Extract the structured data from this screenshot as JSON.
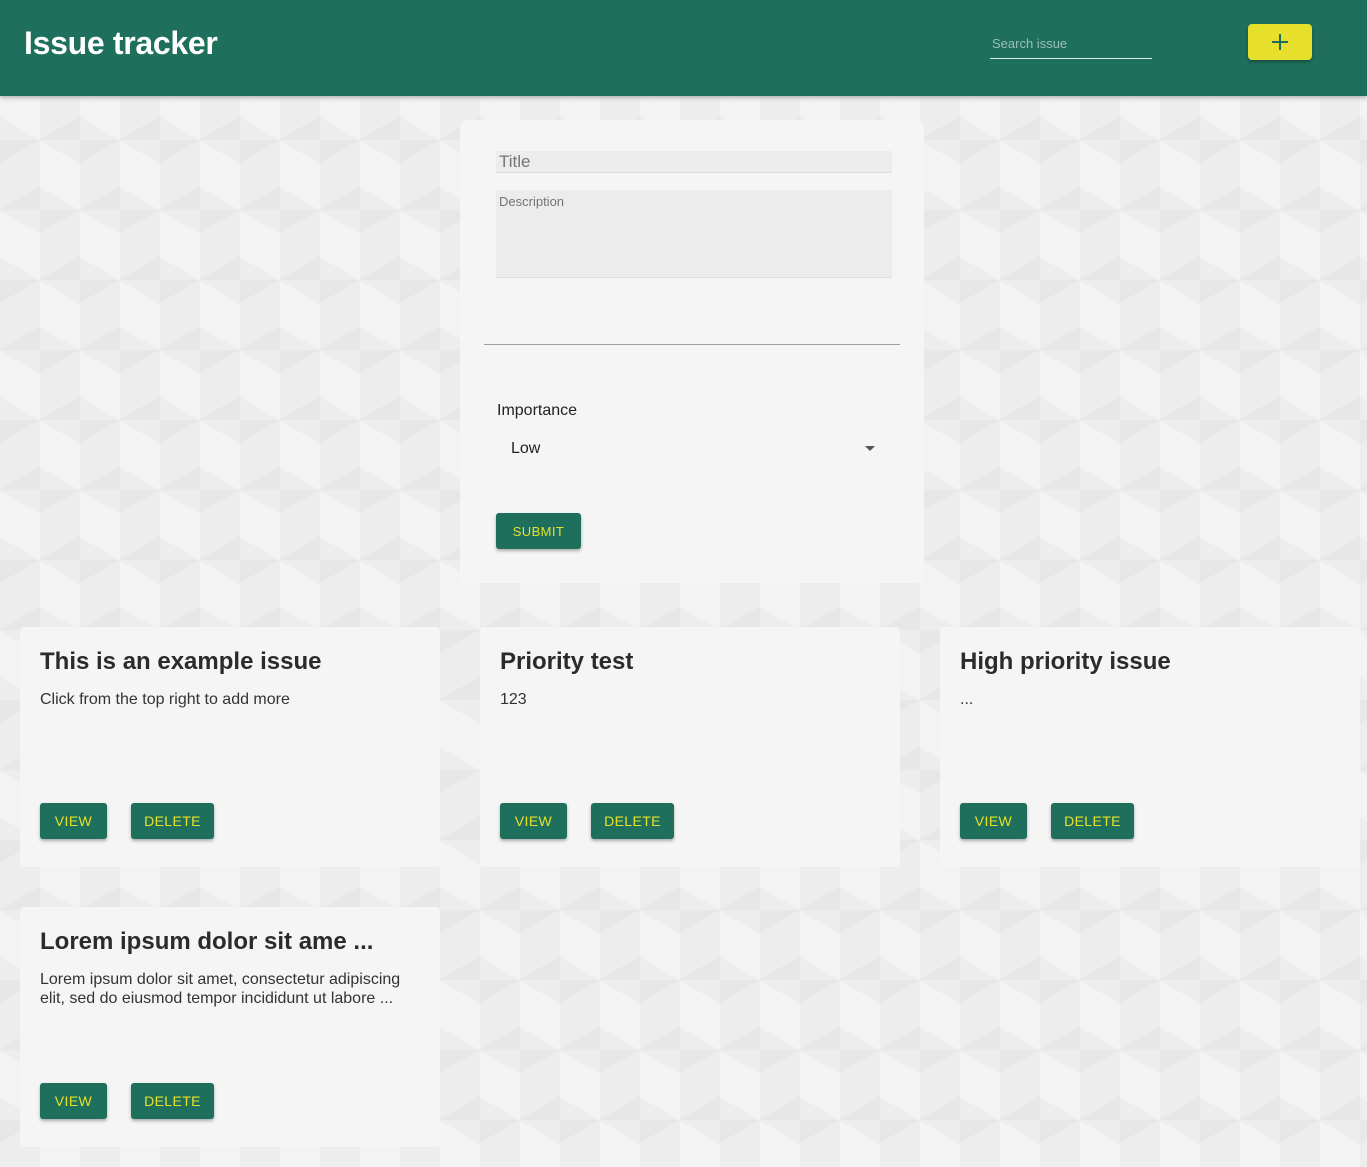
{
  "header": {
    "title": "Issue tracker",
    "search_placeholder": "Search issue",
    "add_icon": "plus-icon",
    "accent_color": "#e6e02c",
    "brand_color": "#1e6f5c"
  },
  "form": {
    "title_placeholder": "Title",
    "description_placeholder": "Description",
    "importance_label": "Importance",
    "importance_value": "Low",
    "submit_label": "SUBMIT"
  },
  "issues": [
    {
      "title": "This is an example issue",
      "description": "Click from the top right to add more",
      "view_label": "VIEW",
      "delete_label": "DELETE"
    },
    {
      "title": "Priority test",
      "description": "123",
      "view_label": "VIEW",
      "delete_label": "DELETE"
    },
    {
      "title": "High priority issue",
      "description": "...",
      "view_label": "VIEW",
      "delete_label": "DELETE"
    },
    {
      "title": "Lorem ipsum dolor sit ame ...",
      "description": "Lorem ipsum dolor sit amet, consectetur adipiscing elit, sed do eiusmod tempor incididunt ut labore ...",
      "view_label": "VIEW",
      "delete_label": "DELETE"
    }
  ]
}
